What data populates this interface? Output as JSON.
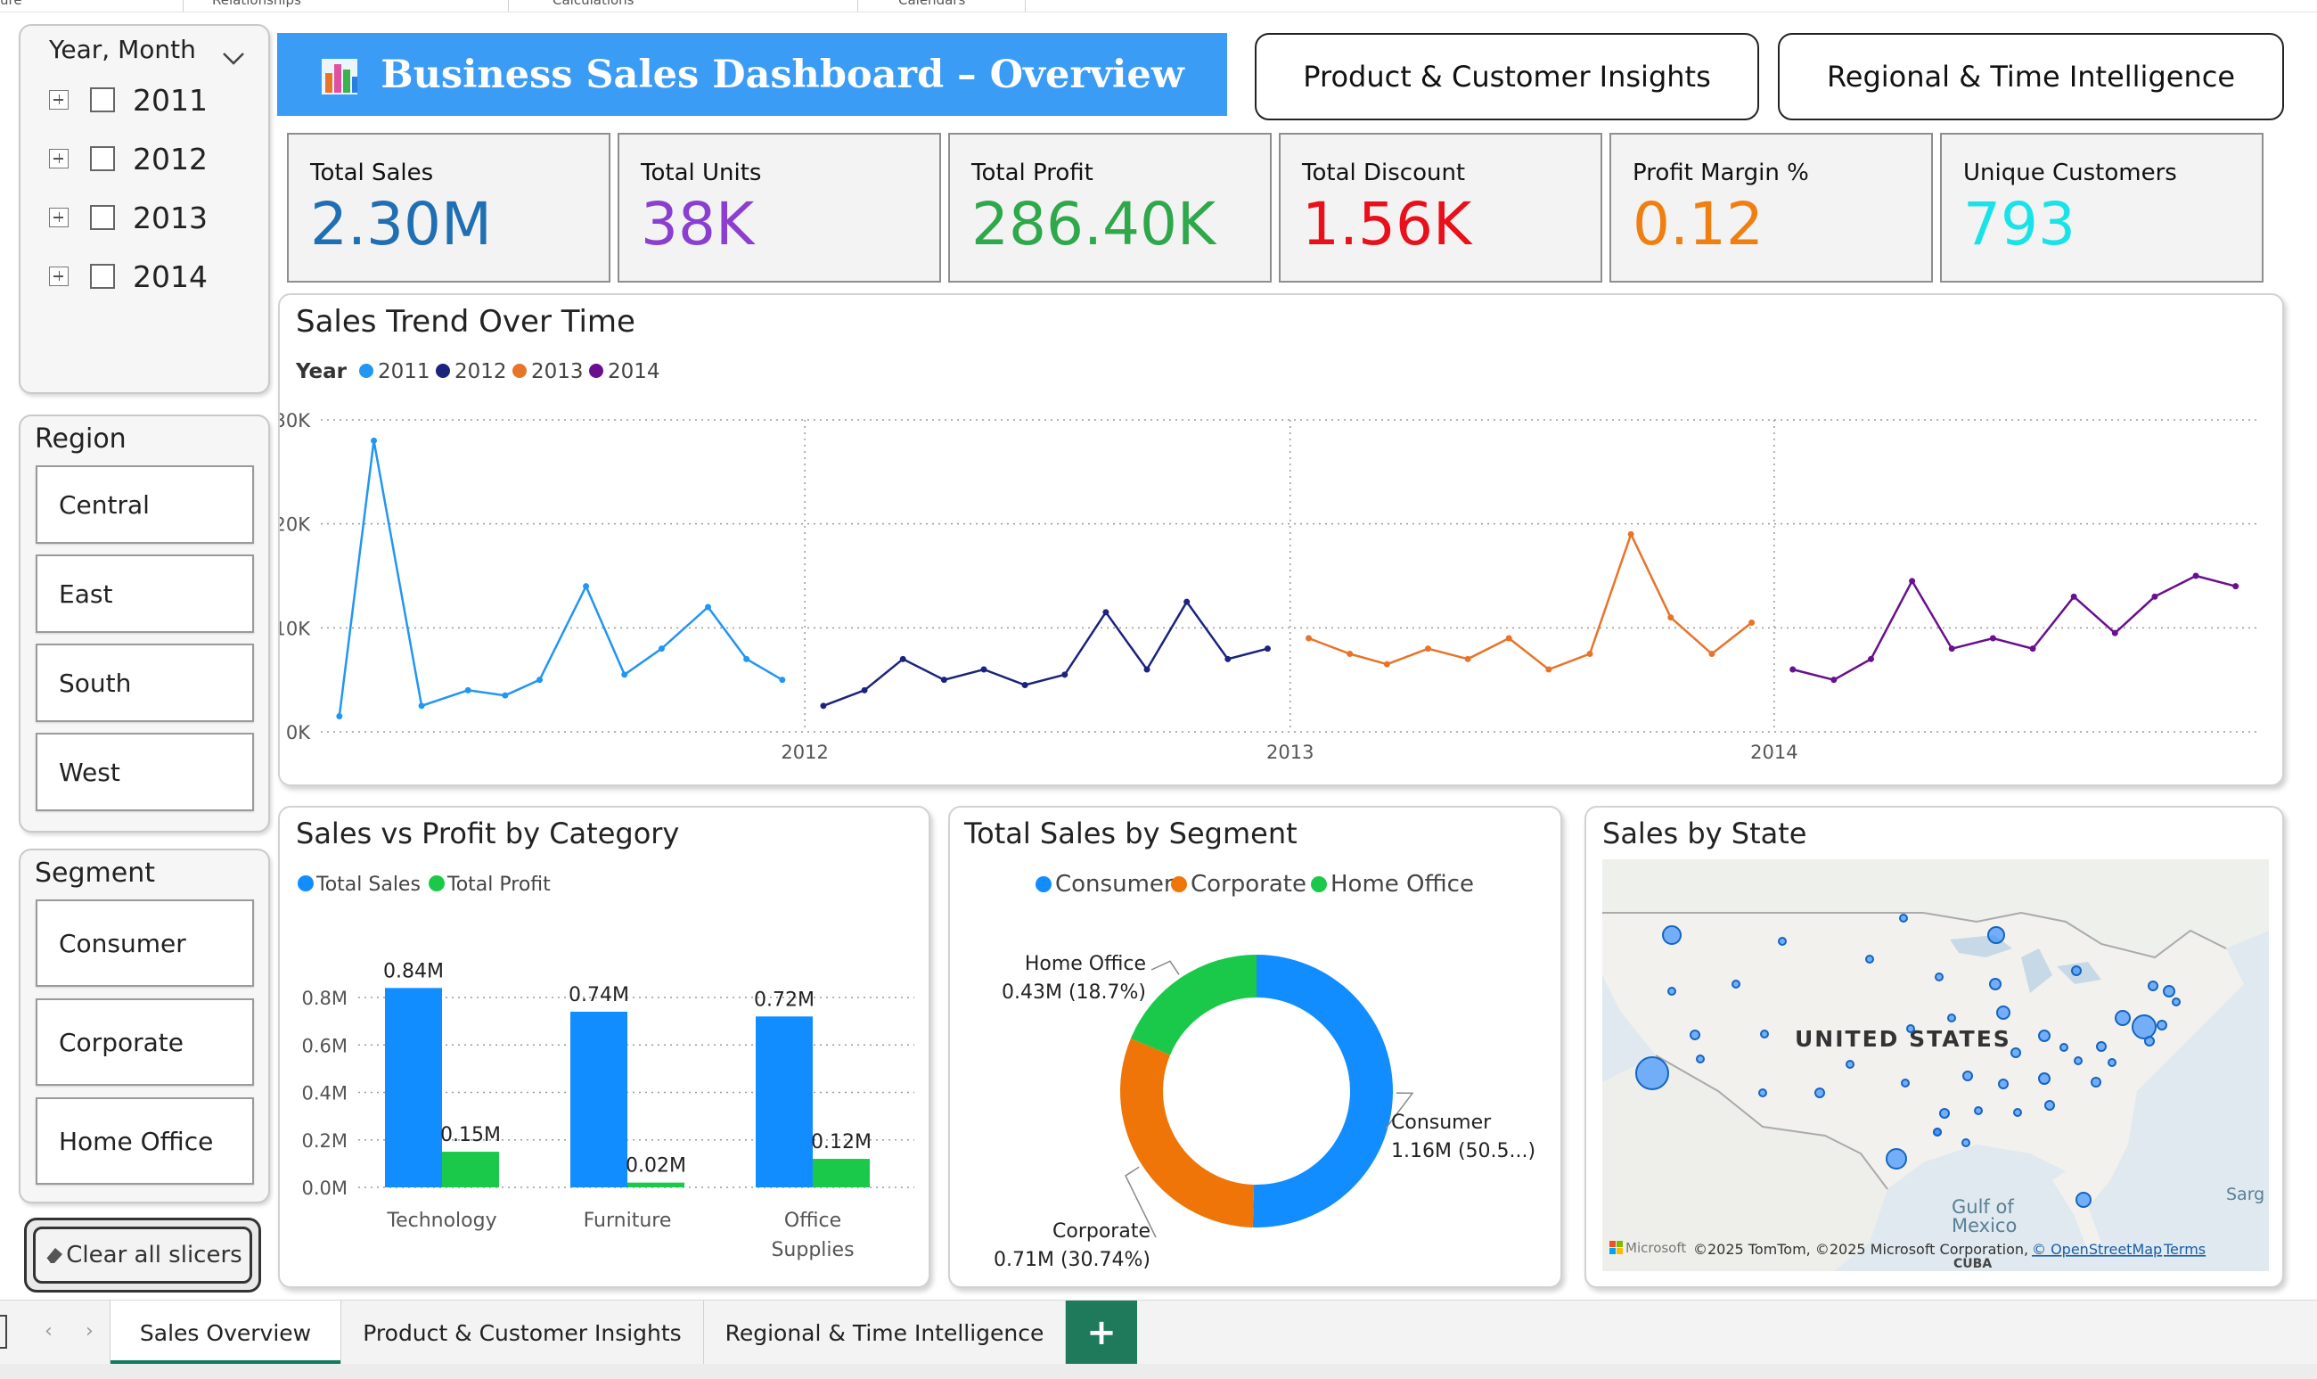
{
  "top_menu": [
    "ure",
    "Relationships",
    "Calculations",
    "Calendars"
  ],
  "slicers": {
    "date": {
      "title": "Year, Month",
      "years": [
        "2011",
        "2012",
        "2013",
        "2014"
      ]
    },
    "region": {
      "title": "Region",
      "items": [
        "Central",
        "East",
        "South",
        "West"
      ]
    },
    "segment": {
      "title": "Segment",
      "items": [
        "Consumer",
        "Corporate",
        "Home Office"
      ]
    },
    "clear_label": "Clear all slicers"
  },
  "header": {
    "title": "Business Sales Dashboard – Overview",
    "nav_buttons": [
      "Product & Customer Insights",
      "Regional & Time Intelligence"
    ]
  },
  "kpis": [
    {
      "label": "Total Sales",
      "value": "2.30M",
      "color": "#1f6fb2"
    },
    {
      "label": "Total Units",
      "value": "38K",
      "color": "#8a3fd1"
    },
    {
      "label": "Total Profit",
      "value": "286.40K",
      "color": "#2ea84a"
    },
    {
      "label": "Total Discount",
      "value": "1.56K",
      "color": "#e8101a"
    },
    {
      "label": "Profit Margin %",
      "value": "0.12",
      "color": "#f07f12"
    },
    {
      "label": "Unique Customers",
      "value": "793",
      "color": "#19e3e8"
    }
  ],
  "visuals": {
    "trend": {
      "title": "Sales Trend Over Time",
      "legend_title": "Year",
      "legend": [
        "2011",
        "2012",
        "2013",
        "2014"
      ]
    },
    "category": {
      "title": "Sales vs Profit by Category",
      "legend": [
        "Total Sales",
        "Total Profit"
      ]
    },
    "segment": {
      "title": "Total Sales by Segment",
      "legend": [
        "Consumer",
        "Corporate",
        "Home Office"
      ]
    },
    "map": {
      "title": "Sales by State",
      "country_label": "UNITED STATES",
      "gulf_label": "Gulf of Mexico",
      "gulf_line1": "Gulf of",
      "gulf_line2": "Mexico",
      "cuba_label": "CUBA",
      "edge_label": "Sarg",
      "attribution": "Microsoft",
      "copyright": "©2025 TomTom, ©2025 Microsoft Corporation,",
      "osm": "© OpenStreetMap",
      "terms": "Terms"
    }
  },
  "tabs": [
    "Sales Overview",
    "Product & Customer Insights",
    "Regional & Time Intelligence"
  ],
  "tab_add": "+",
  "chart_data": [
    {
      "type": "line",
      "title": "Sales Trend Over Time",
      "legend_title": "Year",
      "ylim": [
        0,
        30000
      ],
      "y_ticks": [
        "0K",
        "10K",
        "20K",
        "30K"
      ],
      "x_ticks": [
        "2012",
        "2013",
        "2014"
      ],
      "series": [
        {
          "name": "2011",
          "color": "#2196f3",
          "x": [
            "2011-01-15",
            "2011-02-10",
            "2011-03-18",
            "2011-04-22",
            "2011-05-20",
            "2011-06-15",
            "2011-07-20",
            "2011-08-18",
            "2011-09-15",
            "2011-10-20",
            "2011-11-18",
            "2011-12-15"
          ],
          "values": [
            1500,
            28000,
            2500,
            4000,
            3500,
            5000,
            14000,
            5500,
            8000,
            12000,
            7000,
            5000
          ]
        },
        {
          "name": "2012",
          "color": "#1a237e",
          "x": [
            "2012-01-15",
            "2012-02-15",
            "2012-03-15",
            "2012-04-15",
            "2012-05-15",
            "2012-06-15",
            "2012-07-15",
            "2012-08-15",
            "2012-09-15",
            "2012-10-15",
            "2012-11-15",
            "2012-12-15"
          ],
          "values": [
            2500,
            4000,
            7000,
            5000,
            6000,
            4500,
            5500,
            11500,
            6000,
            12500,
            7000,
            8000
          ]
        },
        {
          "name": "2013",
          "color": "#e8742a",
          "x": [
            "2013-01-15",
            "2013-02-15",
            "2013-03-15",
            "2013-04-15",
            "2013-05-15",
            "2013-06-15",
            "2013-07-15",
            "2013-08-15",
            "2013-09-15",
            "2013-10-15",
            "2013-11-15",
            "2013-12-15"
          ],
          "values": [
            9000,
            7500,
            6500,
            8000,
            7000,
            9000,
            6000,
            7500,
            19000,
            11000,
            7500,
            10500
          ]
        },
        {
          "name": "2014",
          "color": "#6a0f8e",
          "x": [
            "2014-01-15",
            "2014-02-15",
            "2014-03-15",
            "2014-04-15",
            "2014-05-15",
            "2014-06-15",
            "2014-07-15",
            "2014-08-15",
            "2014-09-15",
            "2014-10-15",
            "2014-11-15",
            "2014-12-15"
          ],
          "values": [
            6000,
            5000,
            7000,
            14500,
            8000,
            9000,
            8000,
            13000,
            9500,
            13000,
            15000,
            14000
          ]
        }
      ]
    },
    {
      "type": "bar",
      "title": "Sales vs Profit by Category",
      "categories": [
        "Technology",
        "Furniture",
        "Office Supplies"
      ],
      "ylim": [
        0,
        0.8
      ],
      "y_ticks": [
        "0.0M",
        "0.2M",
        "0.4M",
        "0.6M",
        "0.8M"
      ],
      "series": [
        {
          "name": "Total Sales",
          "color": "#118dff",
          "values": [
            0.84,
            0.74,
            0.72
          ],
          "labels": [
            "0.84M",
            "0.74M",
            "0.72M"
          ]
        },
        {
          "name": "Total Profit",
          "color": "#1ac94a",
          "values": [
            0.15,
            0.02,
            0.12
          ],
          "labels": [
            "0.15M",
            "0.02M",
            "0.12M"
          ]
        }
      ]
    },
    {
      "type": "pie",
      "title": "Total Sales by Segment",
      "donut": true,
      "slices": [
        {
          "name": "Consumer",
          "value": 1.16,
          "label_line1": "Consumer",
          "label_line2": "1.16M (50.5...)",
          "color": "#118dff"
        },
        {
          "name": "Corporate",
          "value": 0.71,
          "label_line1": "Corporate",
          "label_line2": "0.71M (30.74%)",
          "color": "#ef7508"
        },
        {
          "name": "Home Office",
          "value": 0.43,
          "label_line1": "Home Office",
          "label_line2": "0.43M (18.7%)",
          "color": "#1ac94a"
        }
      ]
    }
  ]
}
